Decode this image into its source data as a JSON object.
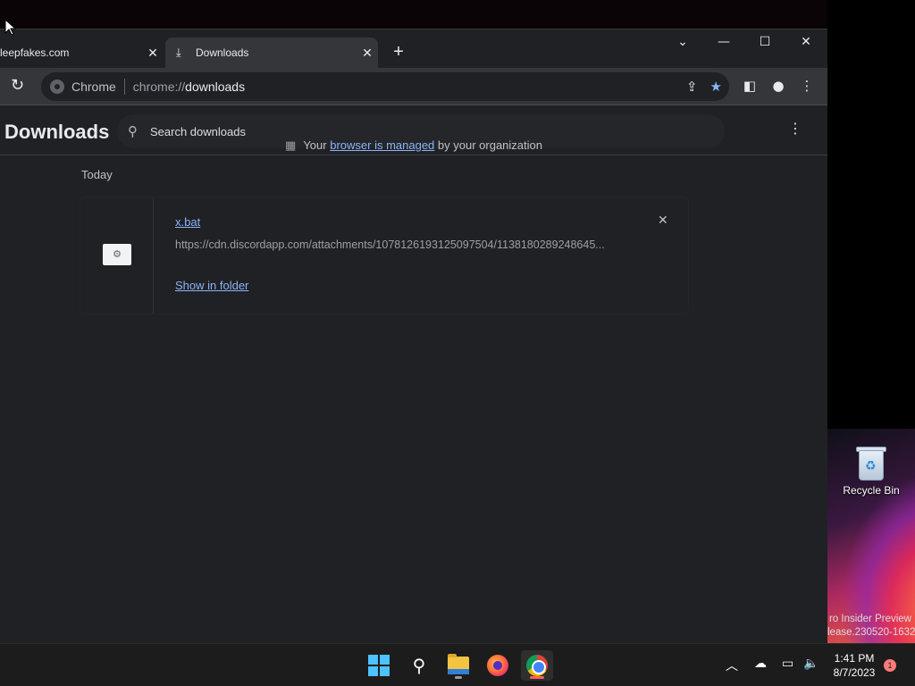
{
  "tabs": [
    {
      "title": "leepfakes.com",
      "close": "✕"
    },
    {
      "title": "Downloads",
      "close": "✕",
      "icon": "download-icon"
    }
  ],
  "new_tab": "+",
  "window_controls": {
    "tab_search": "⌄",
    "minimize": "—",
    "maximize": "☐",
    "close": "✕"
  },
  "omnibox": {
    "label": "Chrome",
    "scheme": "chrome://",
    "host": "downloads"
  },
  "page": {
    "title": "Downloads",
    "search_placeholder": "Search downloads",
    "managed_prefix": "Your",
    "managed_link": "browser is managed",
    "managed_suffix": "by your organization",
    "section": "Today"
  },
  "download": {
    "file_name": "x.bat",
    "url": "https://cdn.discordapp.com/attachments/1078126193125097504/1138180289248645...",
    "show_in_folder": "Show in folder"
  },
  "desktop": {
    "recycle_bin_label": "Recycle Bin",
    "watermark_line1": "ro Insider Preview",
    "watermark_line2": "lease.230520-1632"
  },
  "taskbar": {
    "time": "1:41 PM",
    "date": "8/7/2023",
    "notification_count": "1"
  },
  "colors": {
    "accent": "#8ab4f8",
    "background": "#202124",
    "toolbar": "#35363a"
  }
}
